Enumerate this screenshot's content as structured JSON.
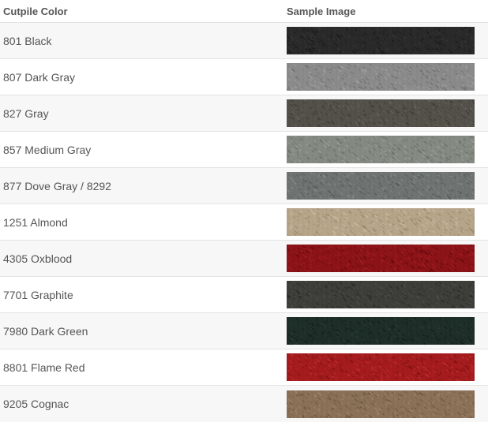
{
  "table": {
    "headers": {
      "color": "Cutpile Color",
      "image": "Sample Image"
    },
    "rows": [
      {
        "name": "801 Black",
        "swatch": "black carpet sample",
        "base": "#2a2a2a",
        "light": "#3a3a3a",
        "dark": "#151515"
      },
      {
        "name": "807 Dark Gray",
        "swatch": "dark gray carpet sample",
        "base": "#8b8b8b",
        "light": "#a8a8a8",
        "dark": "#676767"
      },
      {
        "name": "827 Gray",
        "swatch": "gray carpet sample",
        "base": "#53514a",
        "light": "#6b6961",
        "dark": "#363530"
      },
      {
        "name": "857 Medium Gray",
        "swatch": "medium gray carpet sample",
        "base": "#858a83",
        "light": "#a1a69f",
        "dark": "#646862"
      },
      {
        "name": "877 Dove Gray / 8292",
        "swatch": "dove gray carpet sample",
        "base": "#6f7473",
        "light": "#8b908f",
        "dark": "#505453"
      },
      {
        "name": "1251 Almond",
        "swatch": "almond carpet sample",
        "base": "#b7a58a",
        "light": "#d2c3a8",
        "dark": "#927f64"
      },
      {
        "name": "4305 Oxblood",
        "swatch": "oxblood carpet sample",
        "base": "#8c1418",
        "light": "#ae2428",
        "dark": "#5e080b"
      },
      {
        "name": "7701 Graphite",
        "swatch": "graphite carpet sample",
        "base": "#3e3e3a",
        "light": "#54544f",
        "dark": "#252522"
      },
      {
        "name": "7980 Dark Green",
        "swatch": "dark green carpet sample",
        "base": "#1e2e28",
        "light": "#2e4038",
        "dark": "#101a16"
      },
      {
        "name": "8801 Flame Red",
        "swatch": "flame red carpet sample",
        "base": "#a61c1e",
        "light": "#c8353a",
        "dark": "#760e10"
      },
      {
        "name": "9205 Cognac",
        "swatch": "cognac carpet sample",
        "base": "#8a7157",
        "light": "#a68c71",
        "dark": "#64503a"
      }
    ]
  }
}
